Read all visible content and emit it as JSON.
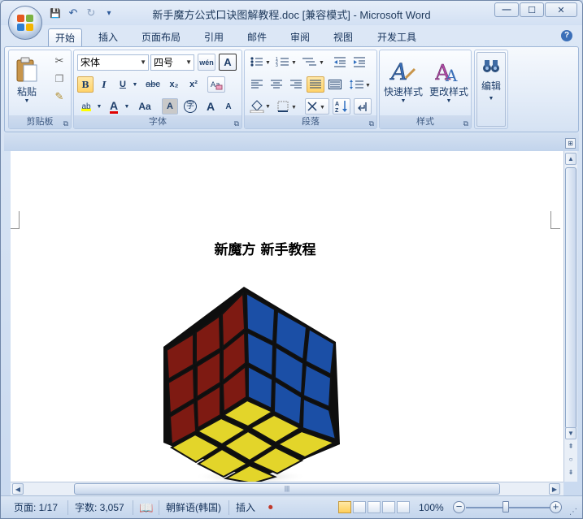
{
  "window": {
    "title": "新手魔方公式口诀图解教程.doc [兼容模式] - Microsoft Word",
    "controls": {
      "minimize": "—",
      "maximize": "☐",
      "close": "✕"
    }
  },
  "quick_access": {
    "save": "💾",
    "undo": "↶",
    "redo": "↻",
    "more": "▾"
  },
  "tabs": [
    "开始",
    "插入",
    "页面布局",
    "引用",
    "邮件",
    "审阅",
    "视图",
    "开发工具"
  ],
  "help": "?",
  "ribbon": {
    "clipboard": {
      "label": "剪贴板",
      "paste": "粘贴"
    },
    "font": {
      "label": "字体",
      "font_name": "宋体",
      "font_size": "四号",
      "wen": "wén",
      "bold": "B",
      "italic": "I",
      "underline": "U",
      "strike": "abc",
      "sub": "x₂",
      "sup": "x²",
      "highlight": "ab",
      "font_color": "A",
      "case": "Aa",
      "char_shade": "A",
      "enclose": "字",
      "grow": "A",
      "shrink": "A"
    },
    "paragraph": {
      "label": "段落"
    },
    "styles": {
      "label": "样式",
      "quick": "快速样式",
      "change": "更改样式"
    },
    "editing": {
      "label": "编辑"
    }
  },
  "document": {
    "title": "新魔方 新手教程"
  },
  "statusbar": {
    "page": "页面: 1/17",
    "words": "字数: 3,057",
    "language": "朝鲜语(韩国)",
    "mode": "插入",
    "zoom": "100%",
    "zoom_minus": "−",
    "zoom_plus": "+"
  },
  "scroll": {
    "hgrip": "|||"
  },
  "colors": {
    "accent": "#2b579a",
    "ribbon_bg": "#dfe9f5",
    "highlight": "#ffd36a"
  }
}
